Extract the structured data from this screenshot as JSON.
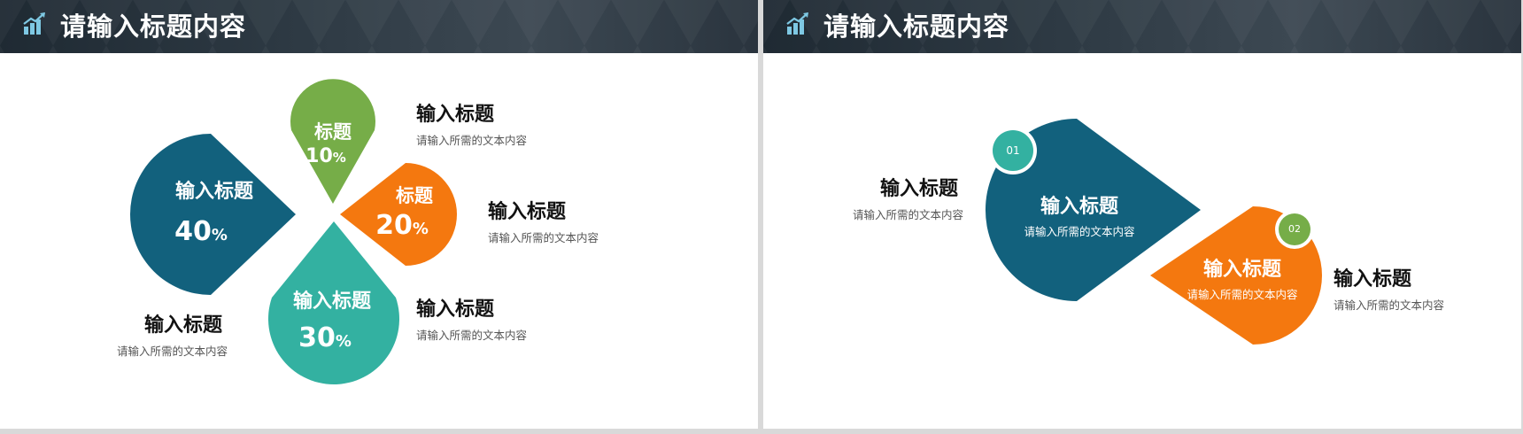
{
  "colors": {
    "teal_dark": "#12617d",
    "teal_light": "#33b1a1",
    "green": "#76ad48",
    "orange": "#f4780f",
    "header_bg": "#2b3640"
  },
  "slides": [
    {
      "header": {
        "title": "请输入标题内容",
        "icon": "chart-growth-icon"
      },
      "shapes": {
        "big": {
          "title": "输入标题",
          "value": "40",
          "unit": "%"
        },
        "green": {
          "title": "标题",
          "value": "10",
          "unit": "%"
        },
        "orange": {
          "title": "标题",
          "value": "20",
          "unit": "%"
        },
        "teal": {
          "title": "输入标题",
          "value": "30",
          "unit": "%"
        }
      },
      "labels": [
        {
          "title": "输入标题",
          "desc": "请输入所需的文本内容"
        },
        {
          "title": "输入标题",
          "desc": "请输入所需的文本内容"
        },
        {
          "title": "输入标题",
          "desc": "请输入所需的文本内容"
        },
        {
          "title": "输入标题",
          "desc": "请输入所需的文本内容"
        }
      ]
    },
    {
      "header": {
        "title": "请输入标题内容",
        "icon": "chart-growth-icon"
      },
      "shapes": {
        "first": {
          "badge": "01",
          "title": "输入标题",
          "desc": "请输入所需的文本内容"
        },
        "second": {
          "badge": "02",
          "title": "输入标题",
          "desc": "请输入所需的文本内容"
        }
      },
      "labels": [
        {
          "title": "输入标题",
          "desc": "请输入所需的文本内容"
        },
        {
          "title": "输入标题",
          "desc": "请输入所需的文本内容"
        }
      ]
    }
  ]
}
